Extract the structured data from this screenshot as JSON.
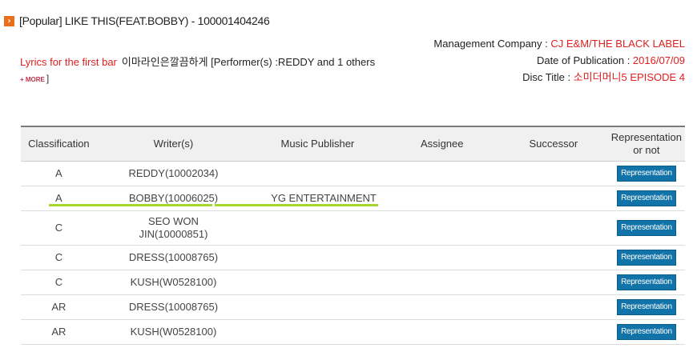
{
  "title": {
    "icon": "arrow-right-icon",
    "text": "[Popular] LIKE THIS(FEAT.BOBBY) - 100001404246"
  },
  "meta": {
    "management_label": "Management Company : ",
    "management_value": "CJ E&M/THE BLACK LABEL",
    "publication_label": "Date of Publication : ",
    "publication_value": "2016/07/09",
    "disc_label": "Disc Title : ",
    "disc_value": "소미더머니5 EPISODE 4"
  },
  "lyrics": {
    "label": "Lyrics for the first bar",
    "text": "이마라인은깔끔하게 [Performer(s) :REDDY and 1 others",
    "more_label": "+ MORE",
    "more_bracket": "]"
  },
  "table": {
    "headers": [
      "Classification",
      "Writer(s)",
      "Music Publisher",
      "Assignee",
      "Successor",
      "Representation or not"
    ],
    "button_label": "Representation",
    "rows": [
      {
        "classification": "A",
        "writer": "REDDY(10002034)",
        "publisher": "",
        "assignee": "",
        "successor": ""
      },
      {
        "classification": "A",
        "writer": "BOBBY(10006025)",
        "publisher": "YG ENTERTAINMENT",
        "assignee": "",
        "successor": ""
      },
      {
        "classification": "C",
        "writer": "SEO WON JIN(10000851)",
        "publisher": "",
        "assignee": "",
        "successor": ""
      },
      {
        "classification": "C",
        "writer": "DRESS(10008765)",
        "publisher": "",
        "assignee": "",
        "successor": ""
      },
      {
        "classification": "C",
        "writer": "KUSH(W0528100)",
        "publisher": "",
        "assignee": "",
        "successor": ""
      },
      {
        "classification": "AR",
        "writer": "DRESS(10008765)",
        "publisher": "",
        "assignee": "",
        "successor": ""
      },
      {
        "classification": "AR",
        "writer": "KUSH(W0528100)",
        "publisher": "",
        "assignee": "",
        "successor": ""
      }
    ]
  },
  "colors": {
    "accent_red": "#e02020",
    "title_icon": "#e8701a",
    "button_blue": "#1273a8",
    "highlight_green": "#a6d630"
  }
}
